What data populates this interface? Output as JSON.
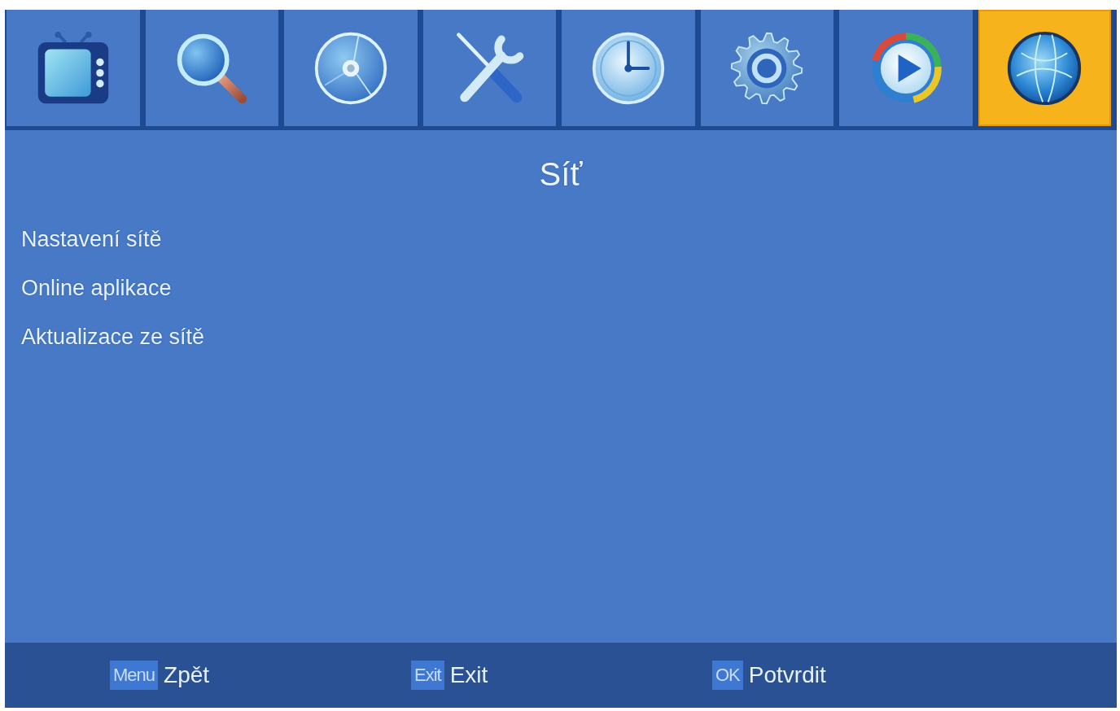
{
  "tabs": [
    {
      "selected": false
    },
    {
      "selected": false
    },
    {
      "selected": false
    },
    {
      "selected": false
    },
    {
      "selected": false
    },
    {
      "selected": false
    },
    {
      "selected": false
    },
    {
      "selected": true
    }
  ],
  "title": "Síť",
  "menu_items": [
    {
      "label": "Nastavení sítě",
      "selected": false
    },
    {
      "label": "Online aplikace",
      "selected": false
    },
    {
      "label": "Aktualizace ze sítě",
      "selected": false
    }
  ],
  "footer_hints": [
    {
      "key": "Menu",
      "label": "Zpět"
    },
    {
      "key": "Exit",
      "label": "Exit"
    },
    {
      "key": "OK",
      "label": "Potvrdit"
    }
  ]
}
